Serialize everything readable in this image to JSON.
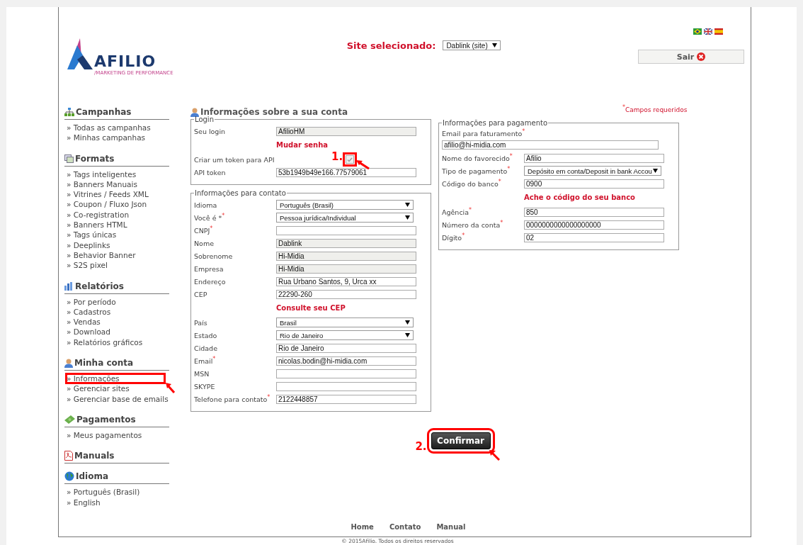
{
  "header": {
    "logo_name": "AFILIO",
    "logo_tagline": "/MARKETING DE PERFORMANCE",
    "site_label": "Site selecionado:",
    "site_select": "Dablink (site)",
    "logout": "Sair"
  },
  "sidebar": [
    {
      "title": "Campanhas",
      "kind": "sitemap",
      "items": [
        {
          "label": "» Todas as campanhas",
          "highlighted": false
        },
        {
          "label": "» Minhas campanhas",
          "highlighted": false
        }
      ]
    },
    {
      "title": "Formats",
      "kind": "formats",
      "items": [
        {
          "label": "» Tags inteligentes",
          "highlighted": false
        },
        {
          "label": "» Banners Manuais",
          "highlighted": false
        },
        {
          "label": "» Vitrines / Feeds XML",
          "highlighted": false
        },
        {
          "label": "» Coupon / Fluxo Json",
          "highlighted": false
        },
        {
          "label": "» Co-registration",
          "highlighted": false
        },
        {
          "label": "» Banners HTML",
          "highlighted": false
        },
        {
          "label": "» Tags únicas",
          "highlighted": false
        },
        {
          "label": "» Deeplinks",
          "highlighted": false
        },
        {
          "label": "» Behavior Banner",
          "highlighted": false
        },
        {
          "label": "» S2S pixel",
          "highlighted": false
        }
      ]
    },
    {
      "title": "Relatórios",
      "kind": "chart",
      "items": [
        {
          "label": "» Por período",
          "highlighted": false
        },
        {
          "label": "» Cadastros",
          "highlighted": false
        },
        {
          "label": "» Vendas",
          "highlighted": false
        },
        {
          "label": "» Download",
          "highlighted": false
        },
        {
          "label": "» Relatórios gráficos",
          "highlighted": false
        }
      ]
    },
    {
      "title": "Minha conta",
      "kind": "user",
      "items": [
        {
          "label": "» Informações",
          "highlighted": true
        },
        {
          "label": "» Gerenciar sites",
          "highlighted": false
        },
        {
          "label": "» Gerenciar base de emails",
          "highlighted": false
        }
      ]
    },
    {
      "title": "Pagamentos",
      "kind": "money",
      "items": [
        {
          "label": "» Meus pagamentos",
          "highlighted": false
        }
      ]
    },
    {
      "title": "Manuals",
      "kind": "pdf"
    },
    {
      "title": "Idioma",
      "kind": "globe",
      "items": [
        {
          "label": "» Português (Brasil)",
          "highlighted": false
        },
        {
          "label": "» English",
          "highlighted": false
        }
      ]
    }
  ],
  "page_title": "Informações sobre a sua conta",
  "required_note": {
    "mark": "*",
    "text": "Campos requeridos"
  },
  "login": {
    "legend": "Login",
    "rows": [
      {
        "kind": "readonly",
        "label": "Seu login",
        "value": "AfilioHM"
      },
      {
        "kind": "link",
        "text": "Mudar senha"
      },
      {
        "kind": "checkbox",
        "label": "Criar um token para API",
        "checked": true,
        "disabled": true,
        "annotation": "1."
      },
      {
        "kind": "text",
        "label": "API token",
        "value": "53b1949b49e166.77579061"
      }
    ]
  },
  "contact": {
    "legend": "Informações para contato",
    "rows": [
      {
        "kind": "select",
        "label": "Idioma",
        "value": "Português (Brasil)"
      },
      {
        "kind": "select",
        "label": "Você é *",
        "mark": "*",
        "value": "Pessoa jurídica/Individual"
      },
      {
        "kind": "text",
        "label": "CNPJ",
        "mark": "*",
        "value": ""
      },
      {
        "kind": "readonly",
        "label": "Nome",
        "value": "Dablink"
      },
      {
        "kind": "readonly",
        "label": "Sobrenome",
        "value": "Hi-Midia"
      },
      {
        "kind": "readonly",
        "label": "Empresa",
        "value": "Hi-Midia"
      },
      {
        "kind": "text",
        "label": "Endereço",
        "value": "Rua Urbano Santos, 9, Urca xx"
      },
      {
        "kind": "text",
        "label": "CEP",
        "value": "22290-260"
      },
      {
        "kind": "link",
        "text": "Consulte seu CEP"
      },
      {
        "kind": "select",
        "label": "País",
        "value": "Brasil"
      },
      {
        "kind": "select",
        "label": "Estado",
        "value": "Rio de Janeiro"
      },
      {
        "kind": "text",
        "label": "Cidade",
        "value": "Rio de Janeiro"
      },
      {
        "kind": "text",
        "label": "Email",
        "mark": "*",
        "value": "nicolas.bodin@hi-midia.com"
      },
      {
        "kind": "text",
        "label": "MSN",
        "value": ""
      },
      {
        "kind": "text",
        "label": "SKYPE",
        "value": ""
      },
      {
        "kind": "text",
        "label": "Telefone para contato",
        "mark": "*",
        "value": "2122448857"
      }
    ]
  },
  "payment": {
    "legend": "Informações para pagamento",
    "rows": [
      {
        "kind": "wide",
        "label": "Email para faturamento",
        "mark": "*",
        "value": "afilio@hi-midia.com"
      },
      {
        "kind": "text",
        "label": "Nome do favorecido",
        "mark": "*",
        "value": "Afilio"
      },
      {
        "kind": "select",
        "label": "Tipo de pagamento",
        "mark": "*",
        "value": "Depósito em conta/Deposit in bank Accou"
      },
      {
        "kind": "text",
        "label": "Código do banco",
        "mark": "*",
        "value": "0900"
      },
      {
        "kind": "link",
        "text": "Ache o código do seu banco"
      },
      {
        "kind": "text",
        "label": "Agência",
        "mark": "*",
        "value": "850"
      },
      {
        "kind": "text",
        "label": "Número da conta",
        "mark": "*",
        "value": "0000000000000000000"
      },
      {
        "kind": "text",
        "label": "Dígito",
        "mark": "*",
        "value": "02"
      }
    ]
  },
  "confirm": {
    "label": "Confirmar",
    "annotation": "2."
  },
  "footer": {
    "links": [
      "Home",
      "Contato",
      "Manual"
    ],
    "copyright": "© 2015Afilio. Todos os direitos reservados"
  }
}
